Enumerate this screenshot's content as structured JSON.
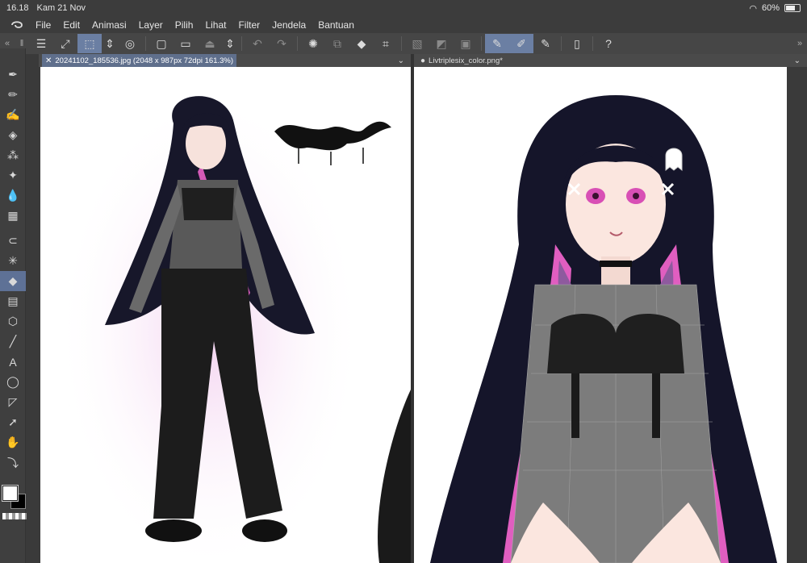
{
  "status": {
    "time": "16.18",
    "date": "Kam 21 Nov",
    "battery": "60%",
    "battery_level": 0.6
  },
  "menu": {
    "items": [
      "File",
      "Edit",
      "Animasi",
      "Layer",
      "Pilih",
      "Lihat",
      "Filter",
      "Jendela",
      "Bantuan"
    ]
  },
  "tabs": {
    "left": "20241102_185536.jpg (2048 x 987px 72dpi 161.3%)",
    "right": "Livtriplesix_color.png*"
  },
  "colors": {
    "accent": "#6b7fa3",
    "chrome": "#3c3c3c",
    "canvas": "#ffffff"
  }
}
